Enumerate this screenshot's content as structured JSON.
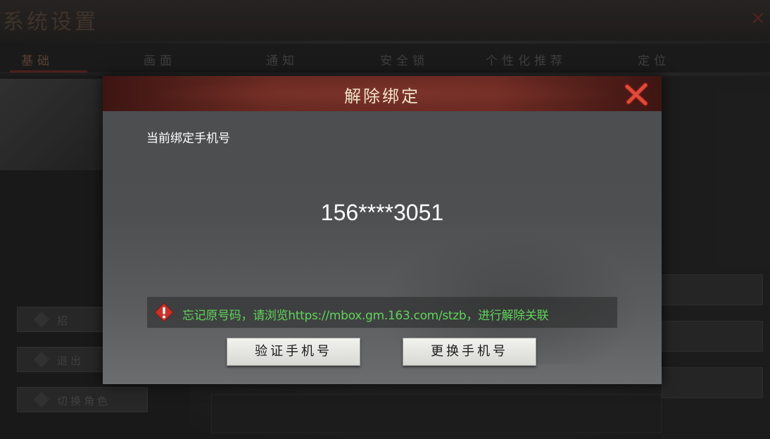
{
  "background": {
    "title": "系统设置",
    "tabs": [
      {
        "label": "基础",
        "active": true
      },
      {
        "label": "画面",
        "active": false
      },
      {
        "label": "通知",
        "active": false
      },
      {
        "label": "安全锁",
        "active": false
      },
      {
        "label": "个性化推荐",
        "active": false
      },
      {
        "label": "定位",
        "active": false
      }
    ],
    "buttons": [
      "招",
      "退出",
      "切换角色"
    ]
  },
  "dialog": {
    "title": "解除绑定",
    "field_label": "当前绑定手机号",
    "phone_number": "156****3051",
    "notice_text": "忘记原号码，请浏览https://mbox.gm.163.com/stzb，进行解除关联",
    "verify_button": "验证手机号",
    "change_button": "更换手机号"
  },
  "colors": {
    "header": "#6a2a22",
    "close_icon": "#d84a3a",
    "notice_text": "#5fd35a",
    "warning_icon": "#c8322a"
  },
  "icons": {
    "close": "close-x-icon",
    "warning": "warning-icon"
  }
}
